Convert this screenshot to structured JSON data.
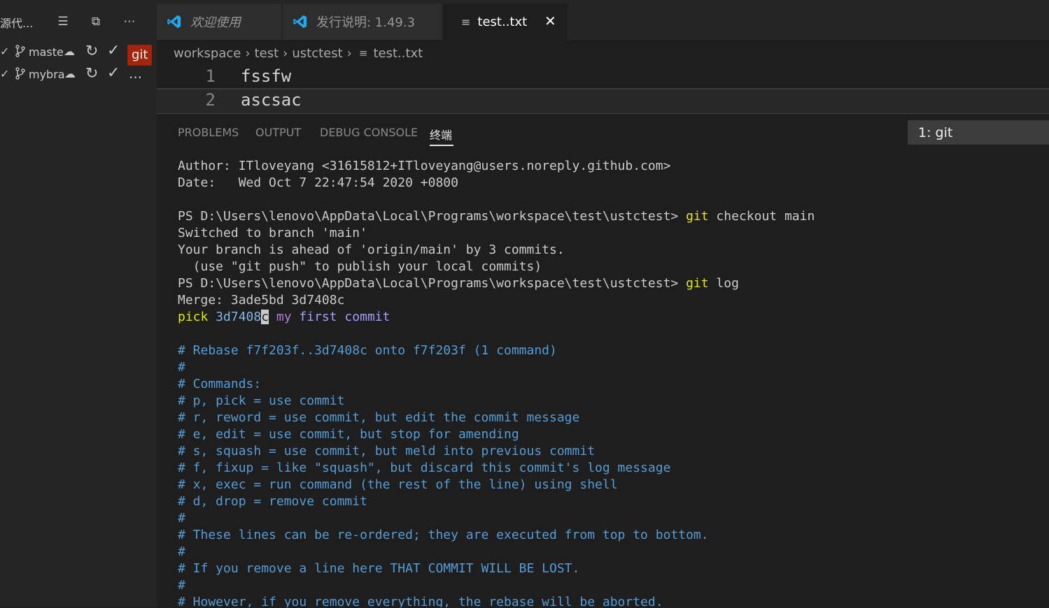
{
  "sidebar": {
    "title": "源代...",
    "repos": [
      {
        "name": "maste",
        "badge": "git"
      },
      {
        "name": "mybra",
        "badge": "..."
      }
    ]
  },
  "tabs": [
    {
      "label": "欢迎使用"
    },
    {
      "label": "发行说明: 1.49.3"
    },
    {
      "label": "test..txt"
    }
  ],
  "breadcrumb": [
    "workspace",
    "test",
    "ustctest",
    "test..txt"
  ],
  "editor": {
    "lines": [
      {
        "num": "1",
        "text": "fssfw"
      },
      {
        "num": "2",
        "text": "ascsac"
      }
    ]
  },
  "panel": {
    "tabs": [
      "PROBLEMS",
      "OUTPUT",
      "DEBUG CONSOLE",
      "终端"
    ],
    "terminal_select": "1: git"
  },
  "terminal": {
    "author": "Author: ITloveyang <31615812+ITloveyang@users.noreply.github.com>",
    "date": "Date:   Wed Oct 7 22:47:54 2020 +0800",
    "prompt": "PS D:\\Users\\lenovo\\AppData\\Local\\Programs\\workspace\\test\\ustctest> ",
    "cmd1_git": "git",
    "cmd1_args": " checkout main",
    "out1": "Switched to branch 'main'",
    "out2": "Your branch is ahead of 'origin/main' by 3 commits.",
    "out3": "  (use \"git push\" to publish your local commits)",
    "cmd2_git": "git",
    "cmd2_args": " log",
    "merge": "Merge: 3ade5bd 3d7408c",
    "pick_word": "pick",
    "pick_hash": " 3d7408",
    "pick_cursor": "c",
    "pick_msg_my": " my",
    "pick_msg_rest": " first commit",
    "comments": [
      "# Rebase f7f203f..3d7408c onto f7f203f (1 command)",
      "#",
      "# Commands:",
      "# p, pick = use commit",
      "# r, reword = use commit, but edit the commit message",
      "# e, edit = use commit, but stop for amending",
      "# s, squash = use commit, but meld into previous commit",
      "# f, fixup = like \"squash\", but discard this commit's log message",
      "# x, exec = run command (the rest of the line) using shell",
      "# d, drop = remove commit",
      "#",
      "# These lines can be re-ordered; they are executed from top to bottom.",
      "#",
      "# If you remove a line here THAT COMMIT WILL BE LOST.",
      "#",
      "# However, if you remove everything, the rebase will be aborted."
    ]
  },
  "colors": {
    "accent_blue": "#23a9f2",
    "badge_red": "#a1260d",
    "terminal_yellow": "#e5e510",
    "comment_blue": "#569cd6",
    "purple": "#b180d7"
  }
}
